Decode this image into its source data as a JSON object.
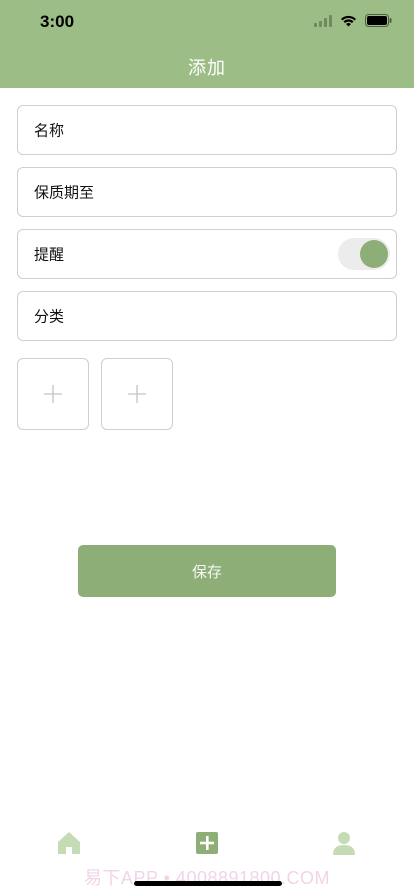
{
  "status_bar": {
    "time": "3:00"
  },
  "header": {
    "title": "添加"
  },
  "form": {
    "name_label": "名称",
    "expiry_label": "保质期至",
    "reminder_label": "提醒",
    "reminder_on": true,
    "category_label": "分类"
  },
  "photos": {
    "slot_count": 2
  },
  "actions": {
    "save_label": "保存"
  },
  "tabbar": {
    "items": [
      "home-icon",
      "add-icon",
      "profile-icon"
    ]
  },
  "watermark": "易下APP • 4008891800.COM",
  "colors": {
    "accent": "#8dae77",
    "header_bg": "#9dbd87"
  }
}
